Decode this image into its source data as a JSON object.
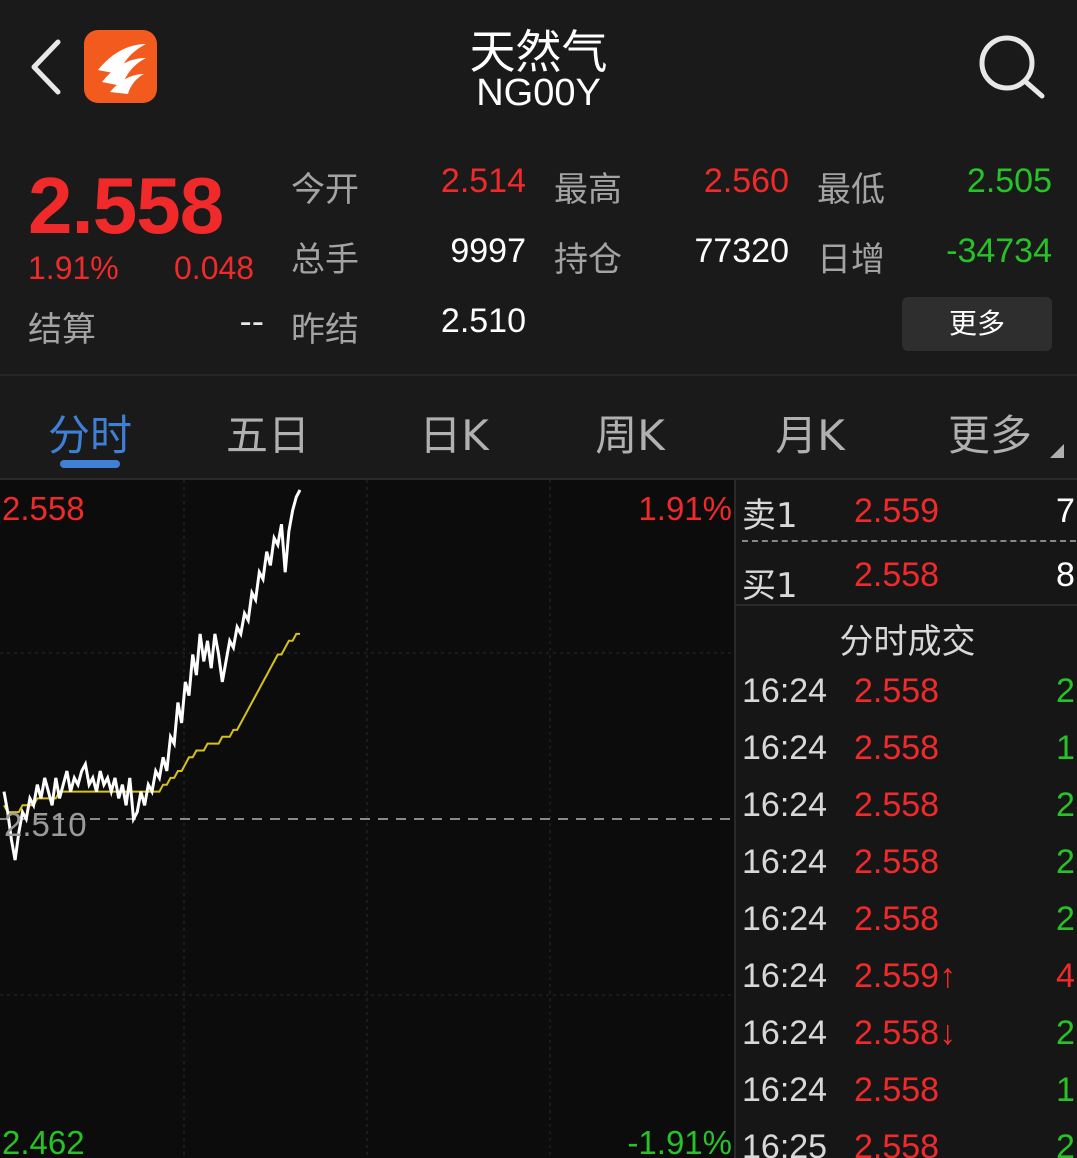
{
  "header": {
    "back_icon": "chevron-left-icon",
    "logo_icon": "app-logo-icon",
    "title": "天然气",
    "code": "NG00Y",
    "search_icon": "search-icon"
  },
  "quote": {
    "price": "2.558",
    "change_pct": "1.91%",
    "change_val": "0.048",
    "settle_label": "结算",
    "settle_val": "--",
    "open_label": "今开",
    "open_val": "2.514",
    "high_label": "最高",
    "high_val": "2.560",
    "low_label": "最低",
    "low_val": "2.505",
    "volume_label": "总手",
    "volume_val": "9997",
    "oi_label": "持仓",
    "oi_val": "77320",
    "daily_inc_label": "日增",
    "daily_inc_val": "-34734",
    "prev_settle_label": "昨结",
    "prev_settle_val": "2.510",
    "more_label": "更多"
  },
  "tabs": [
    {
      "label": "分时",
      "active": true
    },
    {
      "label": "五日",
      "active": false
    },
    {
      "label": "日K",
      "active": false
    },
    {
      "label": "周K",
      "active": false
    },
    {
      "label": "月K",
      "active": false
    },
    {
      "label": "更多",
      "active": false
    }
  ],
  "chart_labels": {
    "top_left": "2.558",
    "top_right": "1.91%",
    "mid_left": "2.510",
    "bottom_left": "2.462",
    "bottom_right": "-1.91%"
  },
  "colors": {
    "up": "#f02a2a",
    "down": "#27c227",
    "accent": "#3f7fd6",
    "avg_line": "#d6c21a",
    "price_line": "#ffffff"
  },
  "chart_data": {
    "type": "line",
    "ylim": [
      2.462,
      2.558
    ],
    "reference": 2.51,
    "series": [
      {
        "name": "",
        "values": [
          2.514,
          2.511,
          2.507,
          2.504,
          2.508,
          2.511,
          2.51,
          2.513,
          2.512,
          2.515,
          2.513,
          2.516,
          2.514,
          2.512,
          2.516,
          2.513,
          2.515,
          2.517,
          2.514,
          2.516,
          2.515,
          2.517,
          2.518,
          2.515,
          2.516,
          2.514,
          2.517,
          2.515,
          2.516,
          2.514,
          2.516,
          2.513,
          2.515,
          2.512,
          2.516,
          2.51,
          2.511,
          2.514,
          2.512,
          2.515,
          2.514,
          2.517,
          2.516,
          2.519,
          2.517,
          2.522,
          2.521,
          2.527,
          2.524,
          2.53,
          2.528,
          2.534,
          2.531,
          2.537,
          2.533,
          2.536,
          2.532,
          2.537,
          2.534,
          2.53,
          2.533,
          2.536,
          2.535,
          2.538,
          2.537,
          2.54,
          2.539,
          2.543,
          2.542,
          2.546,
          2.545,
          2.549,
          2.547,
          2.551,
          2.55,
          2.553,
          2.546,
          2.552,
          2.555,
          2.557,
          2.558
        ]
      },
      {
        "name": "",
        "values": [
          2.512,
          2.511,
          2.511,
          2.511,
          2.511,
          2.512,
          2.512,
          2.512,
          2.512,
          2.513,
          2.513,
          2.513,
          2.513,
          2.513,
          2.513,
          2.514,
          2.514,
          2.514,
          2.514,
          2.514,
          2.514,
          2.514,
          2.514,
          2.514,
          2.514,
          2.514,
          2.514,
          2.514,
          2.514,
          2.514,
          2.514,
          2.514,
          2.514,
          2.514,
          2.514,
          2.514,
          2.514,
          2.514,
          2.514,
          2.514,
          2.514,
          2.514,
          2.514,
          2.515,
          2.515,
          2.516,
          2.516,
          2.517,
          2.517,
          2.518,
          2.519,
          2.519,
          2.52,
          2.52,
          2.52,
          2.521,
          2.521,
          2.521,
          2.521,
          2.522,
          2.522,
          2.522,
          2.523,
          2.523,
          2.524,
          2.525,
          2.526,
          2.527,
          2.528,
          2.529,
          2.53,
          2.531,
          2.532,
          2.533,
          2.534,
          2.534,
          2.535,
          2.536,
          2.536,
          2.537,
          2.537
        ]
      }
    ]
  },
  "order_book": {
    "ask_label": "卖1",
    "ask_price": "2.559",
    "ask_vol": "7",
    "bid_label": "买1",
    "bid_price": "2.558",
    "bid_vol": "8"
  },
  "trades_title": "分时成交",
  "trades": [
    {
      "time": "16:24",
      "price": "2.558",
      "vol": "2",
      "dir": "down"
    },
    {
      "time": "16:24",
      "price": "2.558",
      "vol": "1",
      "dir": "down"
    },
    {
      "time": "16:24",
      "price": "2.558",
      "vol": "2",
      "dir": "down"
    },
    {
      "time": "16:24",
      "price": "2.558",
      "vol": "2",
      "dir": "down"
    },
    {
      "time": "16:24",
      "price": "2.558",
      "vol": "2",
      "dir": "down"
    },
    {
      "time": "16:24",
      "price": "2.559↑",
      "vol": "4",
      "dir": "up"
    },
    {
      "time": "16:24",
      "price": "2.558↓",
      "vol": "2",
      "dir": "down"
    },
    {
      "time": "16:24",
      "price": "2.558",
      "vol": "1",
      "dir": "down"
    },
    {
      "time": "16:25",
      "price": "2.558",
      "vol": "2",
      "dir": "down"
    }
  ]
}
